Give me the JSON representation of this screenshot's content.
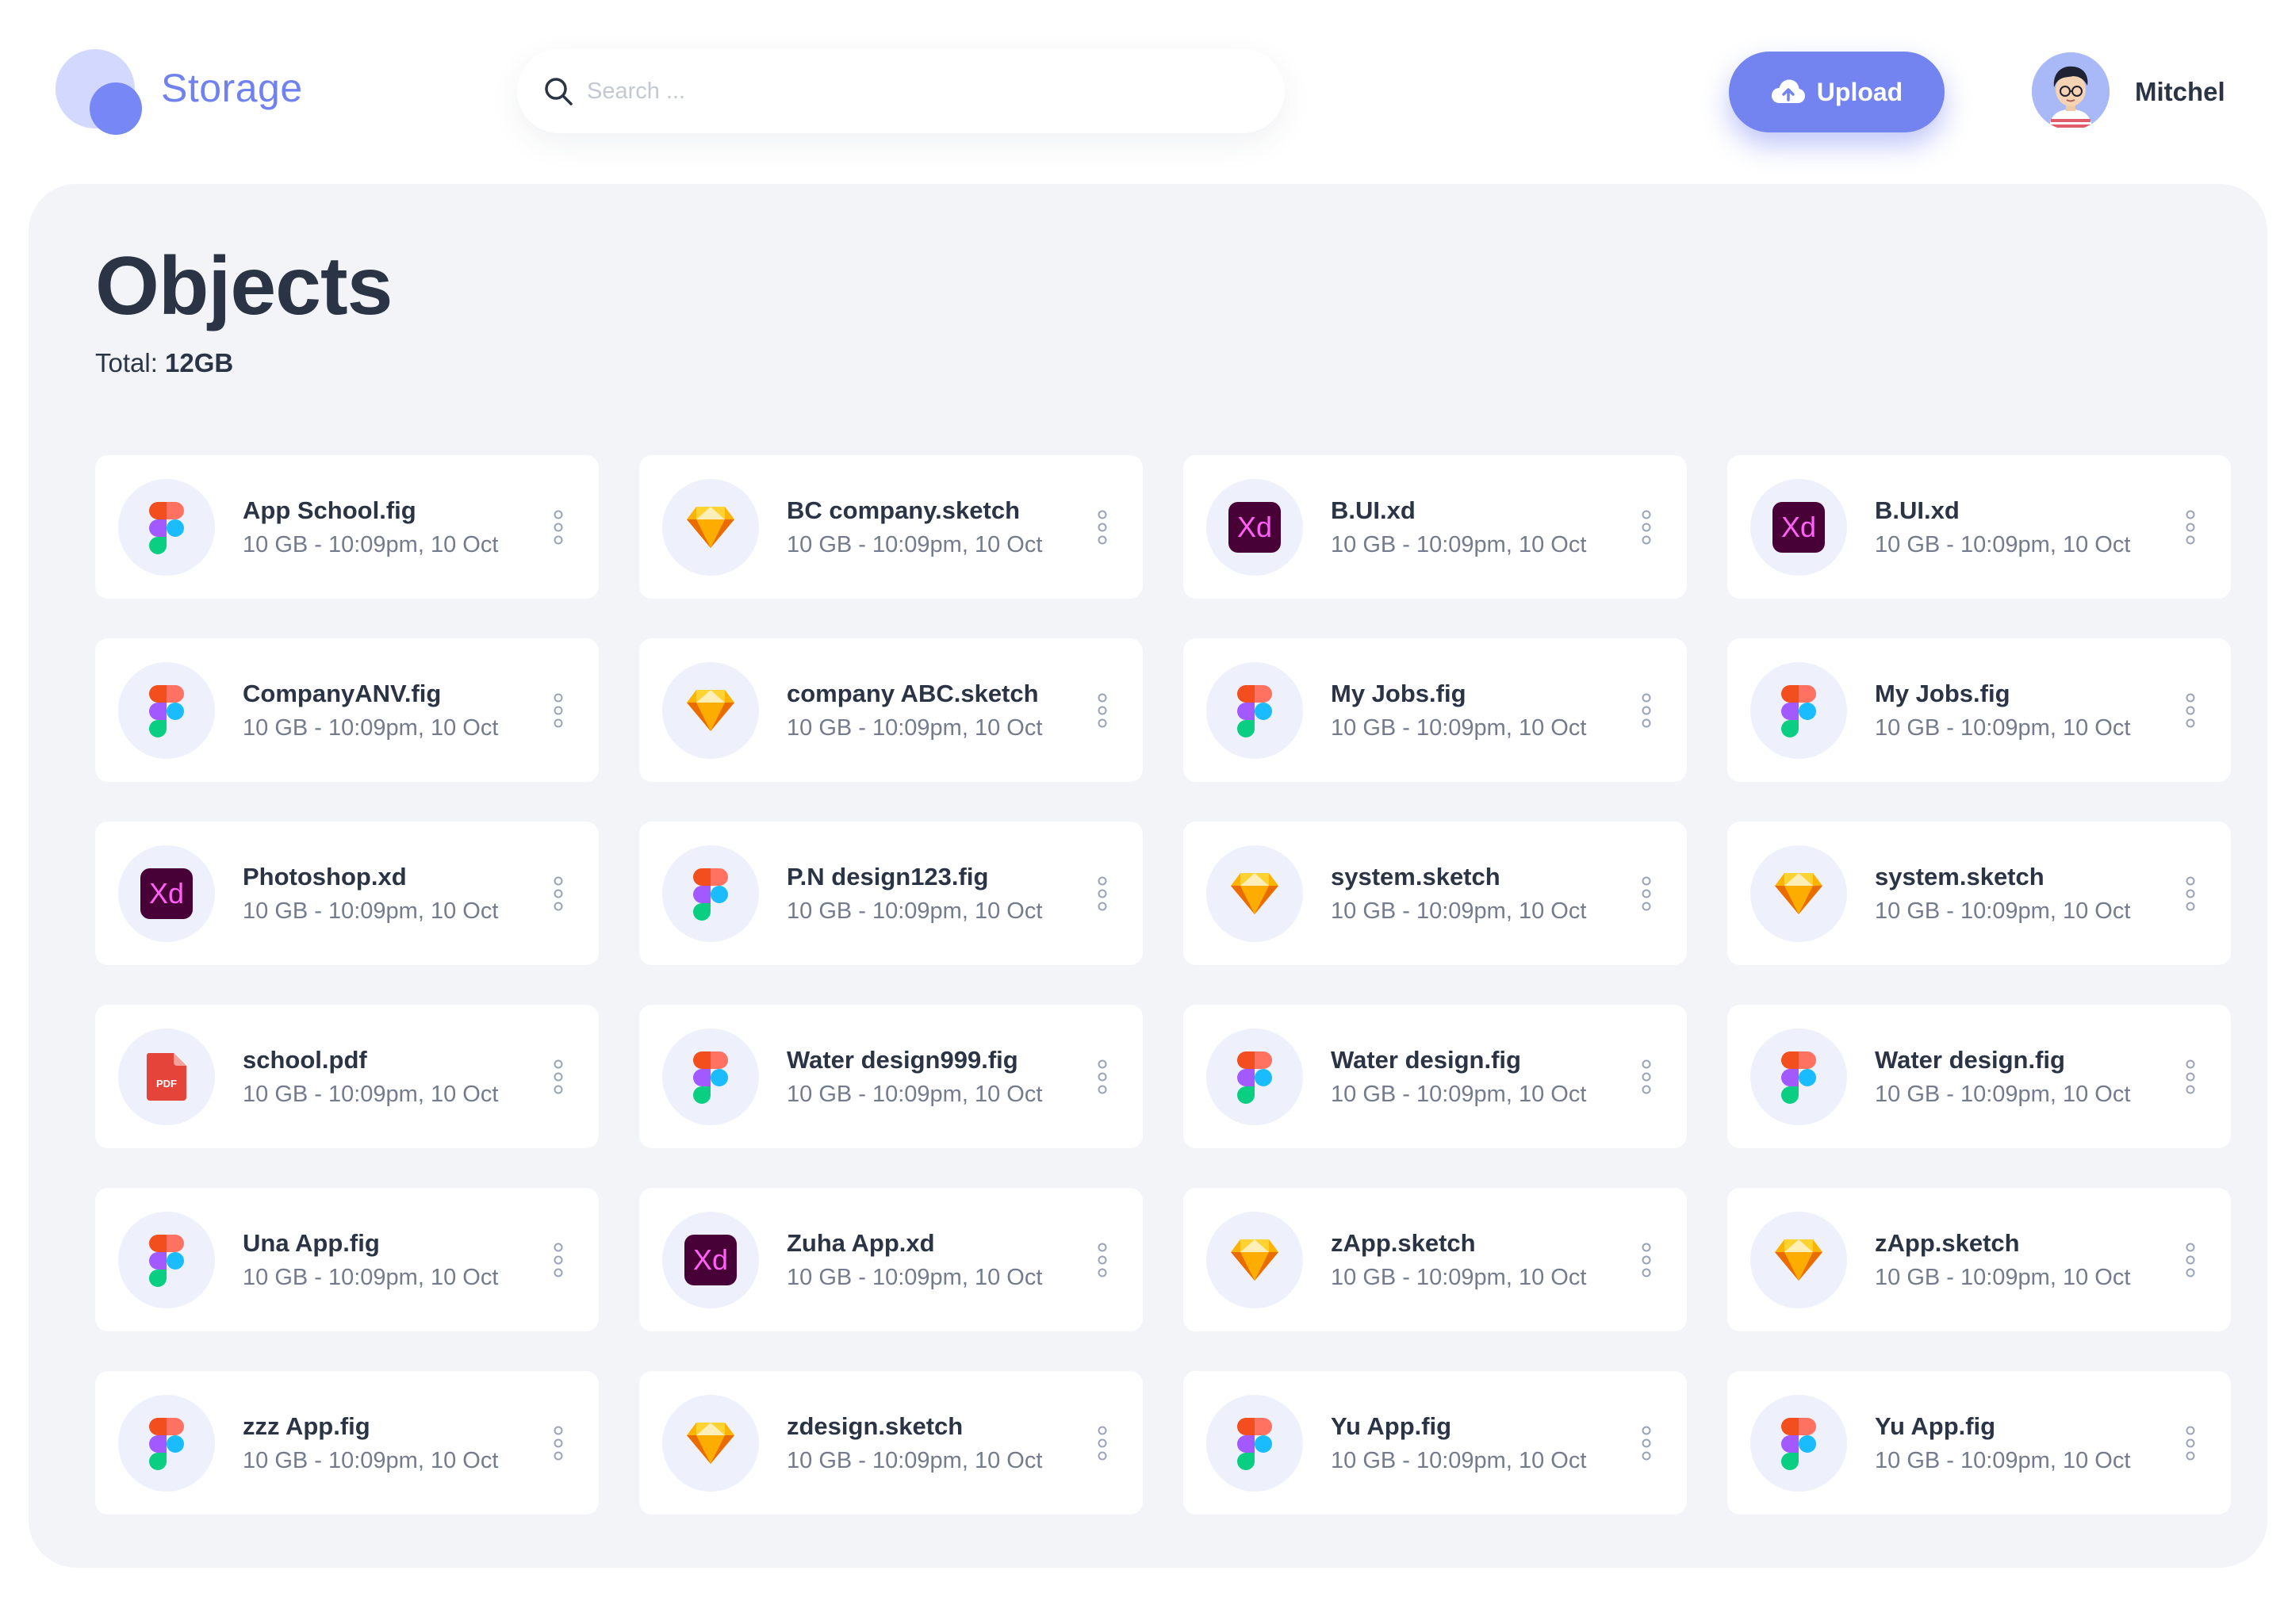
{
  "header": {
    "brand": "Storage",
    "search_placeholder": "Search ...",
    "upload_label": "Upload",
    "user_name": "Mitchel"
  },
  "main": {
    "title": "Objects",
    "total_label": "Total:",
    "total_value": "12GB"
  },
  "colors": {
    "accent": "#7384f1",
    "panel_bg": "#f2f4f8",
    "text_dark": "#2b3445",
    "text_muted": "#737b8c"
  },
  "files": [
    {
      "name": "App School.fig",
      "meta": "10 GB - 10:09pm, 10 Oct",
      "icon": "figma-icon"
    },
    {
      "name": "BC company.sketch",
      "meta": "10 GB - 10:09pm, 10 Oct",
      "icon": "sketch-icon"
    },
    {
      "name": "B.UI.xd",
      "meta": "10 GB - 10:09pm, 10 Oct",
      "icon": "xd-icon"
    },
    {
      "name": "B.UI.xd",
      "meta": "10 GB - 10:09pm, 10 Oct",
      "icon": "xd-icon"
    },
    {
      "name": "CompanyANV.fig",
      "meta": "10 GB - 10:09pm, 10 Oct",
      "icon": "figma-icon"
    },
    {
      "name": "company ABC.sketch",
      "meta": "10 GB - 10:09pm, 10 Oct",
      "icon": "sketch-icon"
    },
    {
      "name": "My Jobs.fig",
      "meta": "10 GB - 10:09pm, 10 Oct",
      "icon": "figma-icon"
    },
    {
      "name": "My Jobs.fig",
      "meta": "10 GB - 10:09pm, 10 Oct",
      "icon": "figma-icon"
    },
    {
      "name": "Photoshop.xd",
      "meta": "10 GB - 10:09pm, 10 Oct",
      "icon": "xd-icon"
    },
    {
      "name": "P.N design123.fig",
      "meta": "10 GB - 10:09pm, 10 Oct",
      "icon": "figma-icon"
    },
    {
      "name": "system.sketch",
      "meta": "10 GB - 10:09pm, 10 Oct",
      "icon": "sketch-icon"
    },
    {
      "name": "system.sketch",
      "meta": "10 GB - 10:09pm, 10 Oct",
      "icon": "sketch-icon"
    },
    {
      "name": "school.pdf",
      "meta": "10 GB - 10:09pm, 10 Oct",
      "icon": "pdf-icon"
    },
    {
      "name": "Water design999.fig",
      "meta": "10 GB - 10:09pm, 10 Oct",
      "icon": "figma-icon"
    },
    {
      "name": "Water design.fig",
      "meta": "10 GB - 10:09pm, 10 Oct",
      "icon": "figma-icon"
    },
    {
      "name": "Water design.fig",
      "meta": "10 GB - 10:09pm, 10 Oct",
      "icon": "figma-icon"
    },
    {
      "name": "Una App.fig",
      "meta": "10 GB - 10:09pm, 10 Oct",
      "icon": "figma-icon"
    },
    {
      "name": "Zuha App.xd",
      "meta": "10 GB - 10:09pm, 10 Oct",
      "icon": "xd-icon"
    },
    {
      "name": "zApp.sketch",
      "meta": "10 GB - 10:09pm, 10 Oct",
      "icon": "sketch-icon"
    },
    {
      "name": "zApp.sketch",
      "meta": "10 GB - 10:09pm, 10 Oct",
      "icon": "sketch-icon"
    },
    {
      "name": "zzz App.fig",
      "meta": "10 GB - 10:09pm, 10 Oct",
      "icon": "figma-icon"
    },
    {
      "name": "zdesign.sketch",
      "meta": "10 GB - 10:09pm, 10 Oct",
      "icon": "sketch-icon"
    },
    {
      "name": "Yu App.fig",
      "meta": "10 GB - 10:09pm, 10 Oct",
      "icon": "figma-icon"
    },
    {
      "name": "Yu App.fig",
      "meta": "10 GB - 10:09pm, 10 Oct",
      "icon": "figma-icon"
    }
  ],
  "icon_text": {
    "xd": "Xd",
    "pdf": "PDF"
  }
}
